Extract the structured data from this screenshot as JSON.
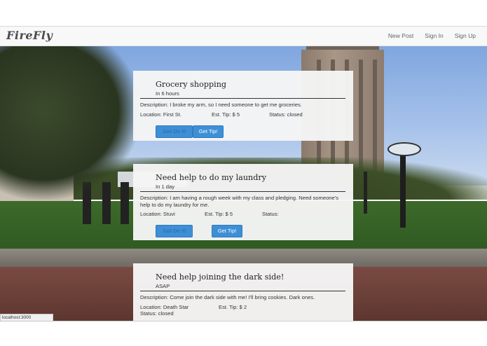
{
  "navbar": {
    "brand": "FireFly",
    "links": [
      "New Post",
      "Sign In",
      "Sign Up"
    ]
  },
  "posts": [
    {
      "title": "Grocery shopping",
      "time": "In 6 hours",
      "description": "Description: I broke my arm, so I need someone to get me groceries.",
      "location": "Location: First St.",
      "tip": "Est. Tip: $ 5",
      "status": "Status: closed",
      "do_label": "Just Do It!",
      "tip_label": "Get Tip!"
    },
    {
      "title": "Need help to do my laundry",
      "time": "In 1 day",
      "description": "Description: I am having a rough week with my class and pledging. Need someone's help to do my laundry for me.",
      "location": "Location: Stuvi",
      "tip": "Est. Tip: $ 5",
      "status": "Status:",
      "do_label": "Just Do It!",
      "tip_label": "Get Tip!"
    },
    {
      "title": "Need help joining the dark side!",
      "time": "ASAP",
      "description": "Description: Come join the dark side with me! I'll bring cookies. Dark ones.",
      "location": "Location: Death Star",
      "tip": "Est. Tip: $ 2",
      "status": "Status: closed"
    }
  ],
  "statusbar": "localhost:3000"
}
